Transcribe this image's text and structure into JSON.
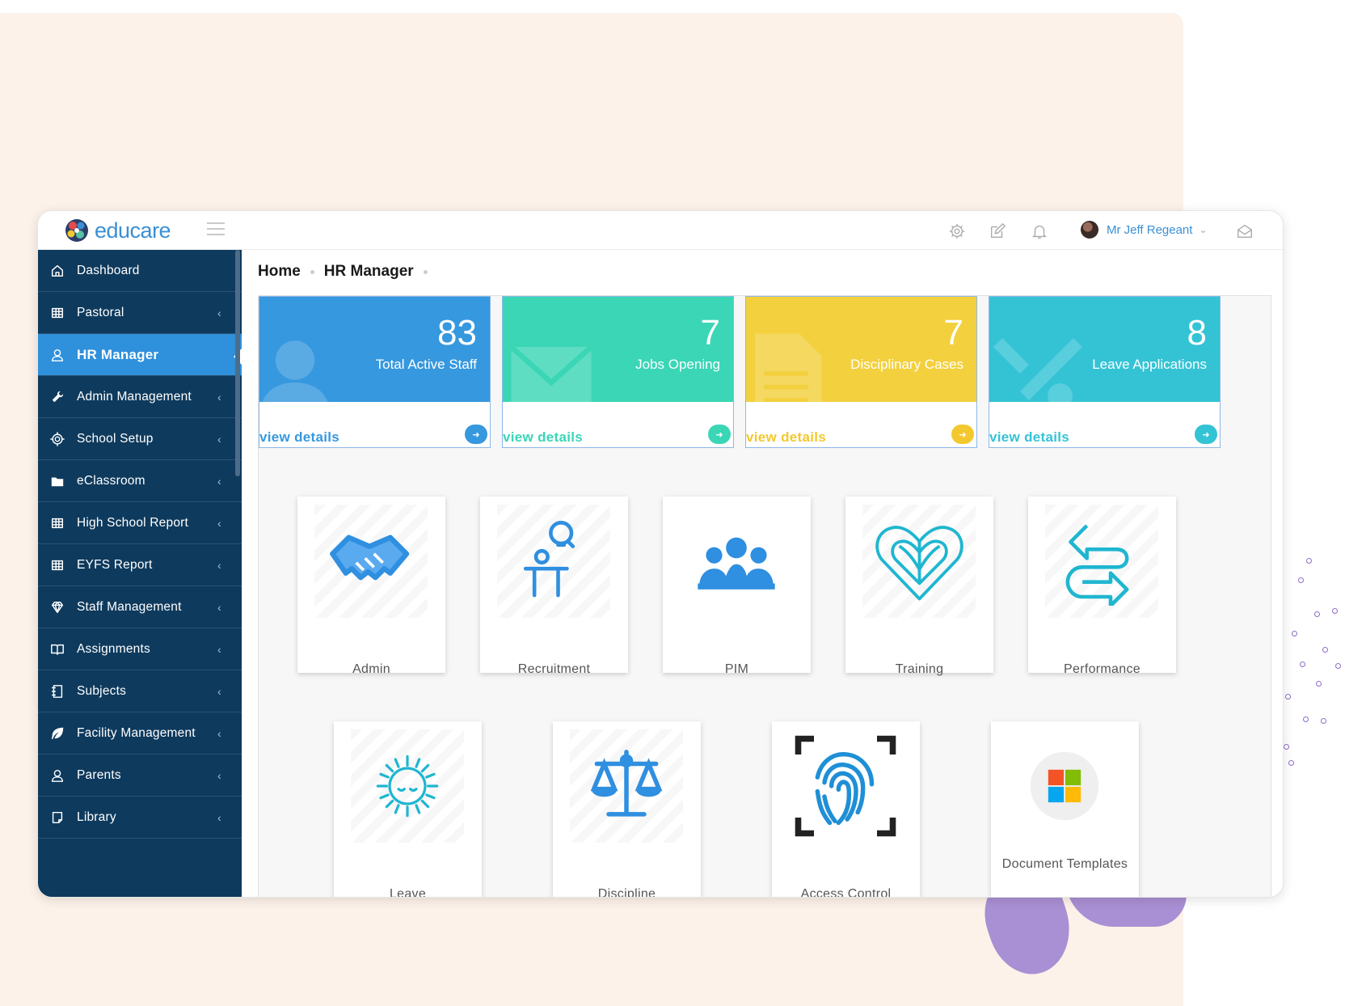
{
  "brand": {
    "name": "educare"
  },
  "user": {
    "name": "Mr Jeff Regeant"
  },
  "breadcrumb": {
    "home": "Home",
    "current": "HR Manager"
  },
  "sidebar": {
    "items": [
      {
        "label": "Dashboard",
        "icon": "home-icon",
        "has_arrow": false,
        "active": false
      },
      {
        "label": "Pastoral",
        "icon": "table-icon",
        "has_arrow": true,
        "active": false
      },
      {
        "label": "HR Manager",
        "icon": "user-icon",
        "has_arrow": false,
        "active": true
      },
      {
        "label": "Admin Management",
        "icon": "wrench-icon",
        "has_arrow": true,
        "active": false
      },
      {
        "label": "School Setup",
        "icon": "gear-icon",
        "has_arrow": true,
        "active": false
      },
      {
        "label": "eClassroom",
        "icon": "folder-icon",
        "has_arrow": true,
        "active": false
      },
      {
        "label": "High School Report",
        "icon": "table-icon",
        "has_arrow": true,
        "active": false
      },
      {
        "label": "EYFS Report",
        "icon": "table-icon",
        "has_arrow": true,
        "active": false
      },
      {
        "label": "Staff Management",
        "icon": "diamond-icon",
        "has_arrow": true,
        "active": false
      },
      {
        "label": "Assignments",
        "icon": "book-icon",
        "has_arrow": true,
        "active": false
      },
      {
        "label": "Subjects",
        "icon": "notebook-icon",
        "has_arrow": true,
        "active": false
      },
      {
        "label": "Facility Management",
        "icon": "leaf-icon",
        "has_arrow": true,
        "active": false
      },
      {
        "label": "Parents",
        "icon": "user-icon",
        "has_arrow": true,
        "active": false
      },
      {
        "label": "Library",
        "icon": "page-icon",
        "has_arrow": true,
        "active": false
      }
    ]
  },
  "stats": [
    {
      "value": "83",
      "label": "Total Active Staff",
      "color": "#3698de",
      "link": "view details",
      "link_color": "#3698de"
    },
    {
      "value": "7",
      "label": "Jobs Opening",
      "color": "#3ad6b6",
      "link": "view details",
      "link_color": "#3ad6b6"
    },
    {
      "value": "7",
      "label": "Disciplinary Cases",
      "color": "#f3d03d",
      "link": "view details",
      "link_color": "#f3c82f"
    },
    {
      "value": "8",
      "label": "Leave Applications",
      "color": "#34c3d5",
      "link": "view details",
      "link_color": "#34c3d5"
    }
  ],
  "modules": [
    {
      "label": "Admin",
      "icon": "handshake-icon"
    },
    {
      "label": "Recruitment",
      "icon": "presenter-icon"
    },
    {
      "label": "PIM",
      "icon": "group-icon"
    },
    {
      "label": "Training",
      "icon": "heart-icon"
    },
    {
      "label": "Performance",
      "icon": "exchange-icon"
    },
    {
      "label": "Leave",
      "icon": "sun-icon"
    },
    {
      "label": "Discipline",
      "icon": "scales-icon"
    },
    {
      "label": "Access Control",
      "icon": "fingerprint-icon"
    },
    {
      "label": "Document Templates",
      "icon": "windows-logo-icon"
    }
  ]
}
